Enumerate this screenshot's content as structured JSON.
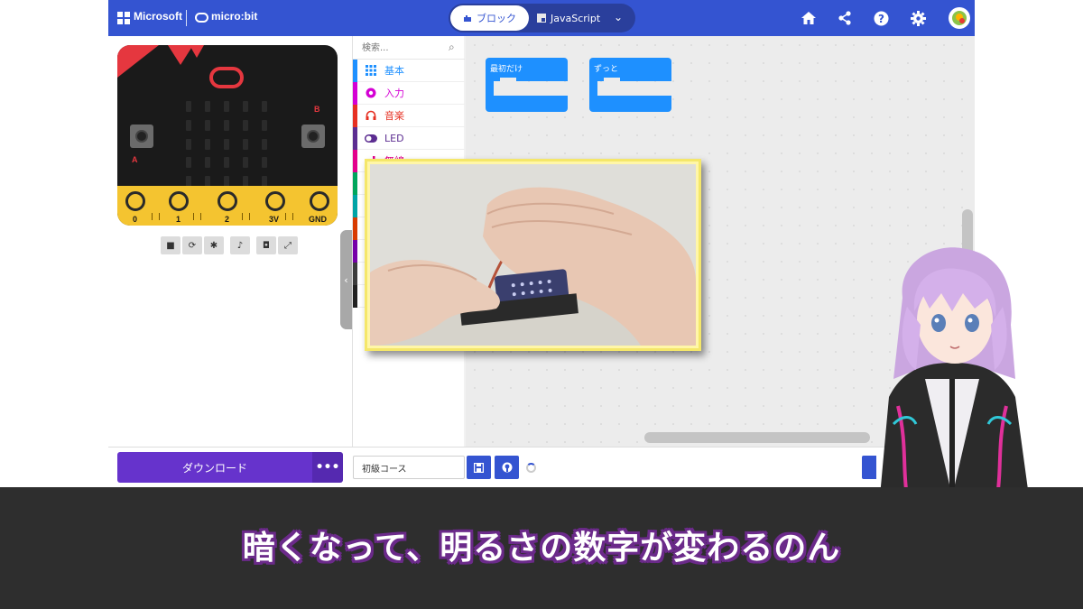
{
  "header": {
    "brand_microsoft": "Microsoft",
    "brand_microbit": "micro:bit",
    "tabs": [
      {
        "label": "ブロック",
        "icon": "puzzle-icon",
        "active": true
      },
      {
        "label": "JavaScript",
        "icon": "js-icon",
        "active": false
      }
    ],
    "actions": [
      "home-icon",
      "share-icon",
      "help-icon",
      "settings-icon",
      "user-avatar"
    ],
    "accent_color": "#3454d1"
  },
  "simulator": {
    "button_a": "A",
    "button_b": "B",
    "pins": [
      "0",
      "1",
      "2",
      "3V",
      "GND"
    ],
    "controls": [
      "stop-icon",
      "restart-icon",
      "debug-icon",
      "sound-icon",
      "screenshot-icon",
      "fullscreen-icon"
    ]
  },
  "toolbox": {
    "search_placeholder": "検索...",
    "categories": [
      {
        "label": "基本",
        "color": "#1e90ff",
        "icon": "grid-icon"
      },
      {
        "label": "入力",
        "color": "#d400d4",
        "icon": "input-icon"
      },
      {
        "label": "音楽",
        "color": "#e63022",
        "icon": "headphones-icon"
      },
      {
        "label": "LED",
        "color": "#5c2d91",
        "icon": "toggle-icon"
      },
      {
        "label": "無線",
        "color": "#e3008c",
        "icon": "signal-icon"
      }
    ]
  },
  "workspace": {
    "blocks": [
      {
        "label": "最初だけ",
        "color": "#1e90ff"
      },
      {
        "label": "ずっと",
        "color": "#1e90ff"
      }
    ]
  },
  "bottombar": {
    "download_label": "ダウンロード",
    "more_label": "•••",
    "project_name": "初級コース"
  },
  "caption": {
    "text": "暗くなって、明るさの数字が変わるのん"
  }
}
